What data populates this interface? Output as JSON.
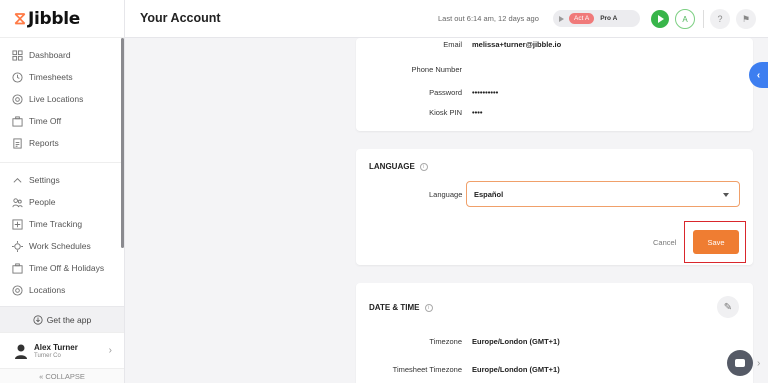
{
  "logo": {
    "mark": "⧖",
    "word": "Jibble"
  },
  "sidebar": {
    "items": [
      {
        "label": "Dashboard"
      },
      {
        "label": "Timesheets"
      },
      {
        "label": "Live Locations"
      },
      {
        "label": "Time Off"
      },
      {
        "label": "Reports"
      }
    ],
    "settings_items": [
      {
        "label": "Settings"
      },
      {
        "label": "People"
      },
      {
        "label": "Time Tracking"
      },
      {
        "label": "Work Schedules"
      },
      {
        "label": "Time Off & Holidays"
      },
      {
        "label": "Locations"
      }
    ],
    "get_app": "Get the app",
    "user": {
      "name": "Alex Turner",
      "org": "Turner Co"
    },
    "collapse": "« COLLAPSE"
  },
  "header": {
    "title": "Your Account",
    "last_out": "Last out 6:14 am, 12 days ago",
    "activity": "Act A",
    "project": "Pro A",
    "avatar_initials": "A"
  },
  "account": {
    "email_label": "Email",
    "email_value": "melissa+turner@jibble.io",
    "phone_label": "Phone Number",
    "phone_value": "",
    "password_label": "Password",
    "password_value": "••••••••••",
    "pin_label": "Kiosk PIN",
    "pin_value": "••••"
  },
  "language": {
    "title": "LANGUAGE",
    "field_label": "Language",
    "selected": "Español",
    "cancel": "Cancel",
    "save": "Save"
  },
  "datetime": {
    "title": "DATE & TIME",
    "timezone_label": "Timezone",
    "timezone_value": "Europe/London (GMT+1)",
    "ts_timezone_label": "Timesheet Timezone",
    "ts_timezone_value": "Europe/London (GMT+1)"
  },
  "colors": {
    "accent": "#ef7d32",
    "green": "#38b54a",
    "blue": "#3d7ef0",
    "highlight": "#d9262c"
  }
}
